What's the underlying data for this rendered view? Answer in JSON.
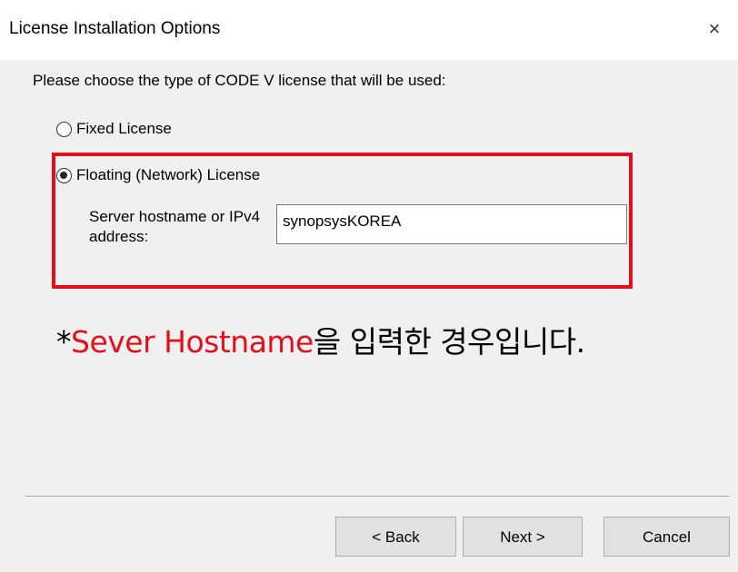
{
  "window": {
    "title": "License Installation Options",
    "close_label": "×"
  },
  "prompt": "Please choose the type of CODE V license that will be used:",
  "options": [
    {
      "label": "Fixed License",
      "selected": false
    },
    {
      "label": "Floating (Network) License",
      "selected": true
    }
  ],
  "server": {
    "label": "Server hostname or IPv4 address:",
    "value": "synopsysKOREA"
  },
  "note": {
    "prefix": "*",
    "highlight": "Sever Hostname",
    "suffix": "을 입력한 경우입니다."
  },
  "buttons": {
    "back": "< Back",
    "next": "Next >",
    "cancel": "Cancel"
  },
  "colors": {
    "highlight": "#e3101b"
  }
}
